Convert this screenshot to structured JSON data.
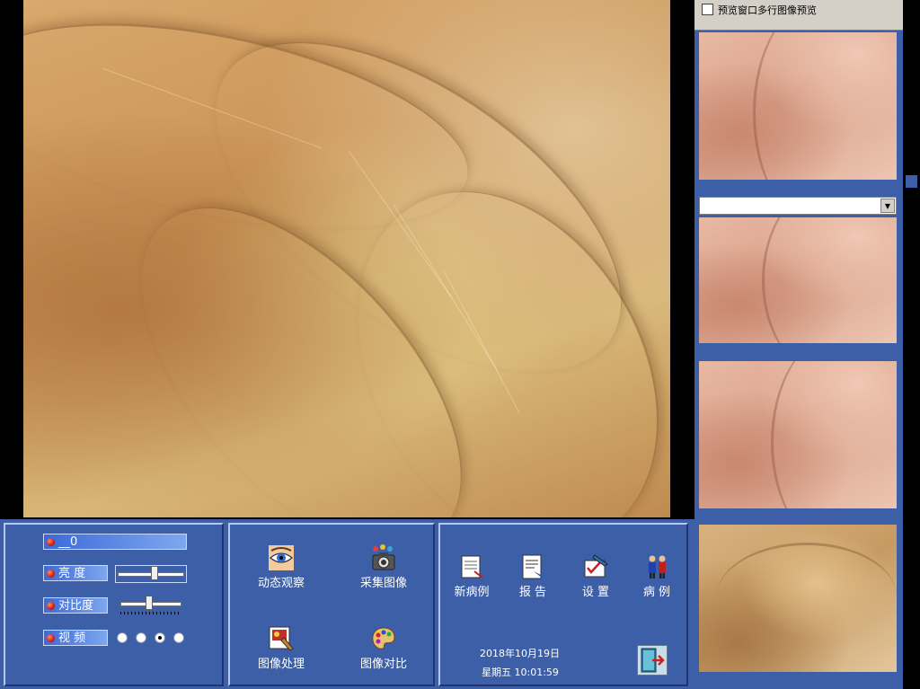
{
  "preview": {
    "checkbox_label": "预览窗口多行图像预览",
    "checkbox_checked": false,
    "select_value": ""
  },
  "adjust": {
    "source_label": "__0",
    "brightness_label": "亮  度",
    "contrast_label": "对比度",
    "video_label": "视  频",
    "brightness_level": 0.55,
    "contrast_level": 0.45,
    "video_options_count": 4,
    "video_selected_index": 2
  },
  "functions": {
    "live_view": "动态观察",
    "capture": "采集图像",
    "process": "图像处理",
    "compare": "图像对比"
  },
  "records": {
    "new_case": "新病例",
    "report": "报 告",
    "settings": "设 置",
    "cases": "病 例",
    "date": "2018年10月19日",
    "time": "星期五 10:01:59"
  },
  "icons": {
    "live_view": "eye-icon",
    "capture": "camera-icon",
    "process": "image-edit-icon",
    "compare": "palette-icon",
    "new_case": "new-record-icon",
    "report": "report-icon",
    "settings": "settings-icon",
    "cases": "patients-icon",
    "exit": "exit-door-icon"
  },
  "colors": {
    "panel_bg": "#3d5fa8",
    "label_gradient_start": "#3b6ad8",
    "label_gradient_end": "#7fa7ee",
    "led": "#d02010"
  }
}
